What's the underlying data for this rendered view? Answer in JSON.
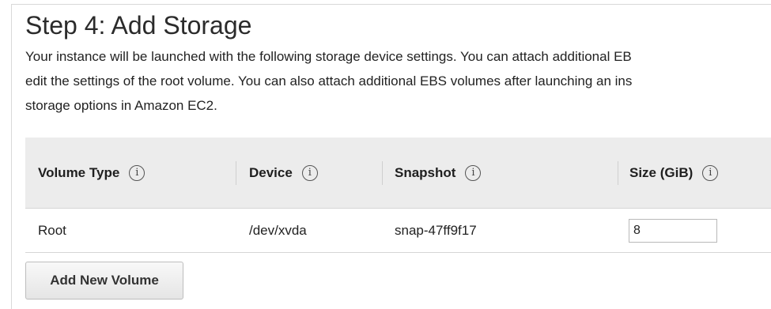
{
  "page": {
    "title": "Step 4: Add Storage",
    "description_lines": [
      "Your instance will be launched with the following storage device settings. You can attach additional EB",
      "edit the settings of the root volume. You can also attach additional EBS volumes after launching an ins"
    ],
    "description_link": "storage options in Amazon EC2."
  },
  "table": {
    "columns": [
      {
        "label": "Volume Type",
        "icon": "info-icon"
      },
      {
        "label": "Device",
        "icon": "info-icon"
      },
      {
        "label": "Snapshot",
        "icon": "info-icon"
      },
      {
        "label": "Size (GiB)",
        "icon": "info-icon"
      }
    ],
    "info_glyph": "i",
    "rows": [
      {
        "volume_type": "Root",
        "device": "/dev/xvda",
        "snapshot": "snap-47ff9f17",
        "size": "8"
      }
    ]
  },
  "actions": {
    "add_volume_label": "Add New Volume"
  }
}
